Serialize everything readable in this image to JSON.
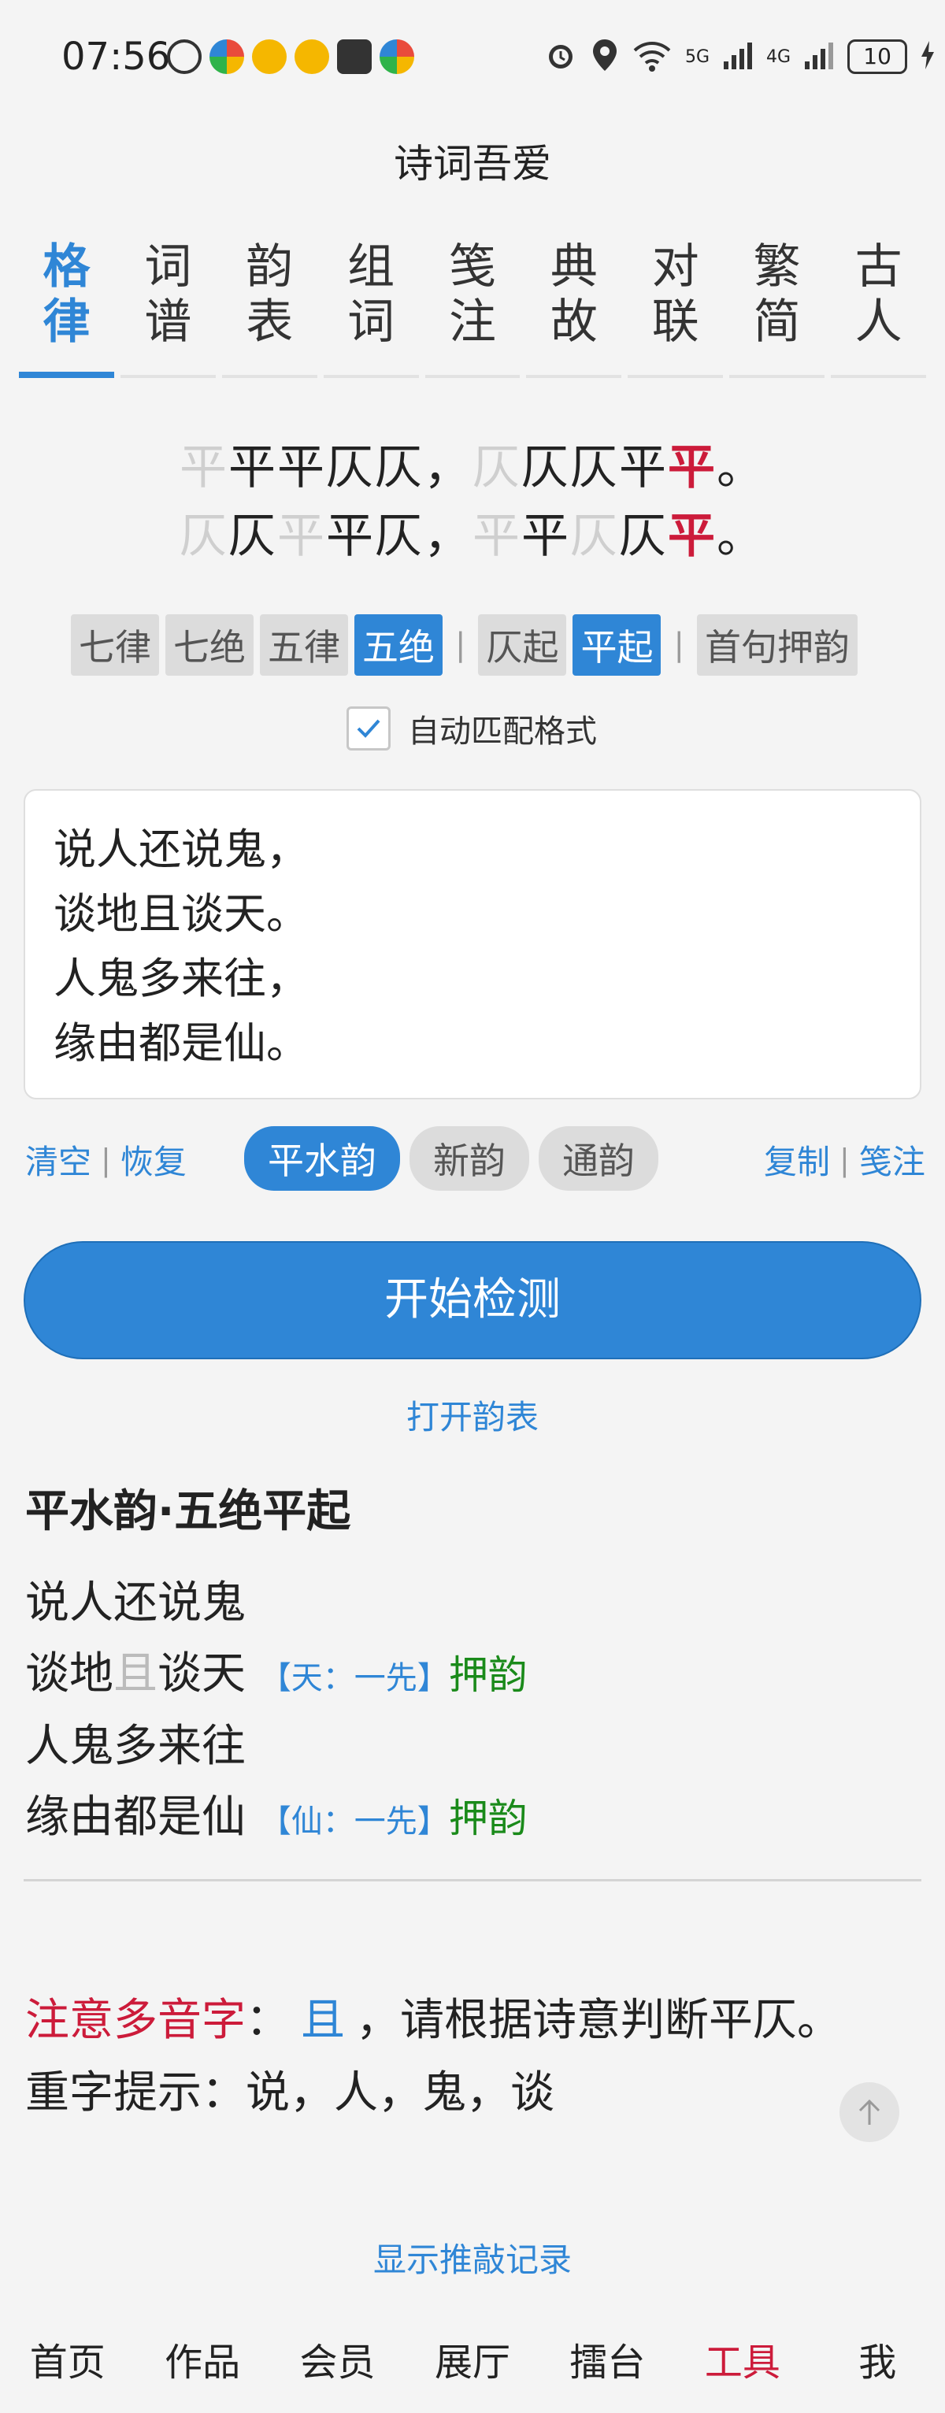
{
  "status_bar": {
    "time": "07:56",
    "network_5g": "5G",
    "network_4g": "4G",
    "battery": "10"
  },
  "app_title": "诗词吾爱",
  "tabs": [
    {
      "label": "格律",
      "active": true
    },
    {
      "label": "词谱",
      "active": false
    },
    {
      "label": "韵表",
      "active": false
    },
    {
      "label": "组词",
      "active": false
    },
    {
      "label": "笺注",
      "active": false
    },
    {
      "label": "典故",
      "active": false
    },
    {
      "label": "对联",
      "active": false
    },
    {
      "label": "繁简",
      "active": false
    },
    {
      "label": "古人",
      "active": false
    }
  ],
  "pattern": {
    "line1": [
      {
        "t": "平",
        "s": "dim"
      },
      {
        "t": "平平仄仄，",
        "s": ""
      },
      {
        "t": "仄",
        "s": "dim"
      },
      {
        "t": "仄仄平",
        "s": ""
      },
      {
        "t": "平",
        "s": "red"
      },
      {
        "t": "。",
        "s": ""
      }
    ],
    "line2": [
      {
        "t": "仄",
        "s": "dim"
      },
      {
        "t": "仄",
        "s": ""
      },
      {
        "t": "平",
        "s": "dim"
      },
      {
        "t": "平仄，",
        "s": ""
      },
      {
        "t": "平",
        "s": "dim"
      },
      {
        "t": "平",
        "s": ""
      },
      {
        "t": "仄",
        "s": "dim"
      },
      {
        "t": "仄",
        "s": ""
      },
      {
        "t": "平",
        "s": "red"
      },
      {
        "t": "。",
        "s": ""
      }
    ]
  },
  "forms": {
    "types": [
      {
        "label": "七律",
        "on": false
      },
      {
        "label": "七绝",
        "on": false
      },
      {
        "label": "五律",
        "on": false
      },
      {
        "label": "五绝",
        "on": true
      }
    ],
    "separator": "|",
    "starts": [
      {
        "label": "仄起",
        "on": false
      },
      {
        "label": "平起",
        "on": true
      }
    ],
    "first_line_rhyme": "首句押韵"
  },
  "auto_match": {
    "label": "自动匹配格式",
    "checked": true
  },
  "poem": {
    "lines": [
      "说人还说鬼，",
      "谈地且谈天。",
      "人鬼多来往，",
      "缘由都是仙。"
    ]
  },
  "actions": {
    "clear": "清空",
    "restore": "恢复",
    "copy": "复制",
    "annotate": "笺注",
    "separator": "|"
  },
  "rhymes": [
    {
      "label": "平水韵",
      "on": true
    },
    {
      "label": "新韵",
      "on": false
    },
    {
      "label": "通韵",
      "on": false
    }
  ],
  "start_button": "开始检测",
  "open_rhyme_table": "打开韵表",
  "result": {
    "title": "平水韵·五绝平起",
    "line1": "说人还说鬼",
    "line2_a": "谈地",
    "line2_dim": "且",
    "line2_b": "谈天",
    "line2_tag": "【天：一先】",
    "line2_ok": "押韵",
    "line3": "人鬼多来往",
    "line4": "缘由都是仙",
    "line4_tag": "【仙：一先】",
    "line4_ok": "押韵"
  },
  "notice": {
    "prefix": "注意多音字",
    "colon": "：",
    "char": "且",
    "suffix": "，请根据诗意判断平仄。"
  },
  "repeat_hint": "重字提示：说，人，鬼，谈",
  "show_record": "显示推敲记录",
  "bottom_nav": [
    {
      "label": "首页",
      "active": false
    },
    {
      "label": "作品",
      "active": false
    },
    {
      "label": "会员",
      "active": false
    },
    {
      "label": "展厅",
      "active": false
    },
    {
      "label": "擂台",
      "active": false
    },
    {
      "label": "工具",
      "active": true
    },
    {
      "label": "我",
      "active": false
    }
  ],
  "colors": {
    "accent": "#2f86d6",
    "red": "#cc1b3a",
    "green": "#1a8a1a",
    "background": "#f4f4f4"
  }
}
